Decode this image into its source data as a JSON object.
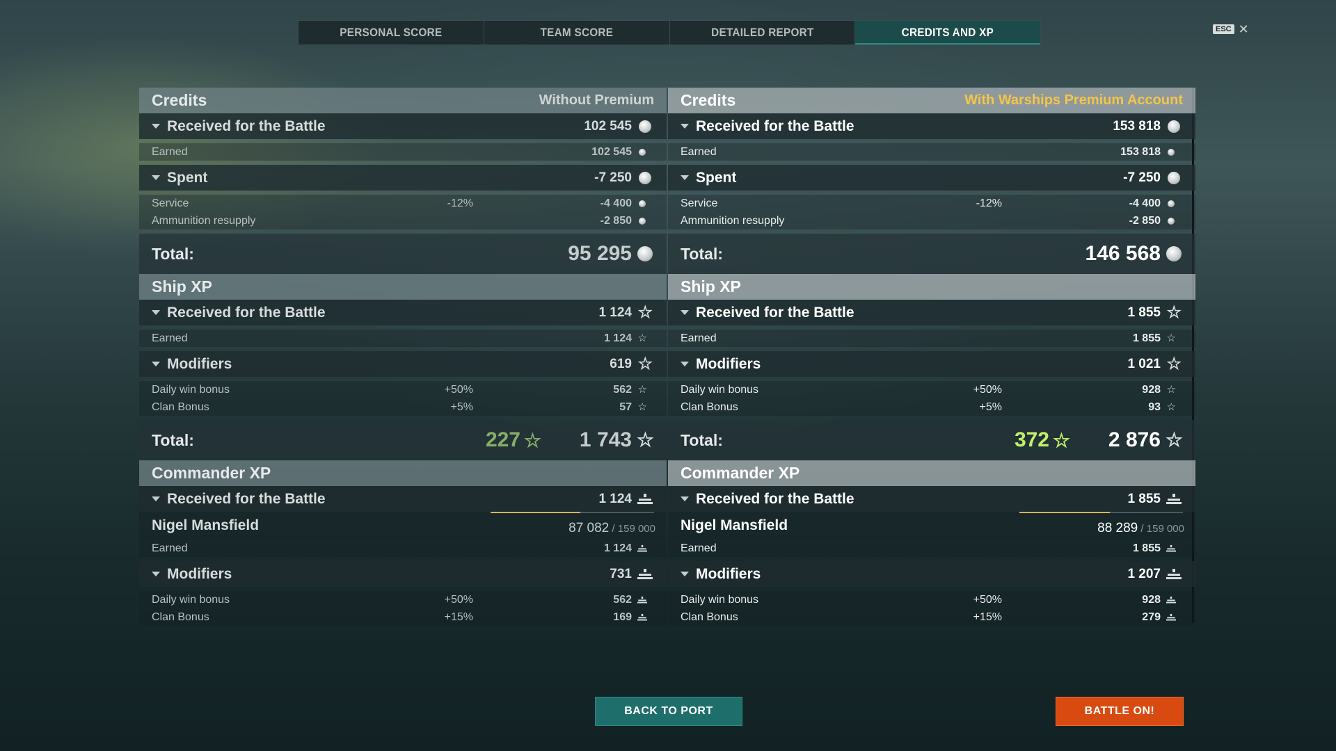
{
  "tabs": [
    {
      "label": "PERSONAL SCORE",
      "active": false
    },
    {
      "label": "TEAM SCORE",
      "active": false
    },
    {
      "label": "DETAILED REPORT",
      "active": false
    },
    {
      "label": "CREDITS AND XP",
      "active": true
    }
  ],
  "esc_label": "ESC",
  "close_symbol": "✕",
  "icons": {
    "credits": "silver-coin-icon",
    "xp": "star-icon",
    "commander_xp": "commander-xp-icon",
    "expand": "caret-down-icon"
  },
  "colors": {
    "premium_label": "#f5c548",
    "free_xp_left": "#88ad6a",
    "free_xp_right": "#c2f06a",
    "back_to_port": "#1e6f6c",
    "battle_on": "#d84a10",
    "active_tab": "#1b4b4a"
  },
  "columns": [
    {
      "credits": {
        "title": "Credits",
        "account_label": "Without Premium",
        "received": {
          "label": "Received for the Battle",
          "value": "102 545"
        },
        "earned": {
          "label": "Earned",
          "value": "102 545"
        },
        "spent": {
          "label": "Spent",
          "value": "-7 250"
        },
        "service": {
          "label": "Service",
          "pct": "-12%",
          "value": "-4 400"
        },
        "ammo": {
          "label": "Ammunition resupply",
          "value": "-2 850"
        },
        "total": {
          "label": "Total:",
          "value": "95 295"
        }
      },
      "ship_xp": {
        "title": "Ship XP",
        "received": {
          "label": "Received for the Battle",
          "value": "1 124"
        },
        "earned": {
          "label": "Earned",
          "value": "1 124"
        },
        "modifiers": {
          "label": "Modifiers",
          "value": "619"
        },
        "daily": {
          "label": "Daily win bonus",
          "pct": "+50%",
          "value": "562"
        },
        "clan": {
          "label": "Clan Bonus",
          "pct": "+5%",
          "value": "57"
        },
        "total": {
          "label": "Total:",
          "free_xp": "227",
          "value": "1 743"
        }
      },
      "commander_xp": {
        "title": "Commander XP",
        "received": {
          "label": "Received for the Battle",
          "value": "1 124"
        },
        "commander": {
          "name": "Nigel Mansfield",
          "xp": "87 082",
          "max": " / 159 000",
          "progress": 0.548
        },
        "earned": {
          "label": "Earned",
          "value": "1 124"
        },
        "modifiers": {
          "label": "Modifiers",
          "value": "731"
        },
        "daily": {
          "label": "Daily win bonus",
          "pct": "+50%",
          "value": "562"
        },
        "clan": {
          "label": "Clan Bonus",
          "pct": "+15%",
          "value": "169"
        }
      }
    },
    {
      "credits": {
        "title": "Credits",
        "account_label": "With Warships Premium Account",
        "received": {
          "label": "Received for the Battle",
          "value": "153 818"
        },
        "earned": {
          "label": "Earned",
          "value": "153 818"
        },
        "spent": {
          "label": "Spent",
          "value": "-7 250"
        },
        "service": {
          "label": "Service",
          "pct": "-12%",
          "value": "-4 400"
        },
        "ammo": {
          "label": "Ammunition resupply",
          "value": "-2 850"
        },
        "total": {
          "label": "Total:",
          "value": "146 568"
        }
      },
      "ship_xp": {
        "title": "Ship XP",
        "received": {
          "label": "Received for the Battle",
          "value": "1 855"
        },
        "earned": {
          "label": "Earned",
          "value": "1 855"
        },
        "modifiers": {
          "label": "Modifiers",
          "value": "1 021"
        },
        "daily": {
          "label": "Daily win bonus",
          "pct": "+50%",
          "value": "928"
        },
        "clan": {
          "label": "Clan Bonus",
          "pct": "+5%",
          "value": "93"
        },
        "total": {
          "label": "Total:",
          "free_xp": "372",
          "value": "2 876"
        }
      },
      "commander_xp": {
        "title": "Commander XP",
        "received": {
          "label": "Received for the Battle",
          "value": "1 855"
        },
        "commander": {
          "name": "Nigel Mansfield",
          "xp": "88 289",
          "max": " / 159 000",
          "progress": 0.555
        },
        "earned": {
          "label": "Earned",
          "value": "1 855"
        },
        "modifiers": {
          "label": "Modifiers",
          "value": "1 207"
        },
        "daily": {
          "label": "Daily win bonus",
          "pct": "+50%",
          "value": "928"
        },
        "clan": {
          "label": "Clan Bonus",
          "pct": "+15%",
          "value": "279"
        }
      }
    }
  ],
  "buttons": {
    "back_to_port": "BACK TO PORT",
    "battle_on": "BATTLE ON!"
  }
}
